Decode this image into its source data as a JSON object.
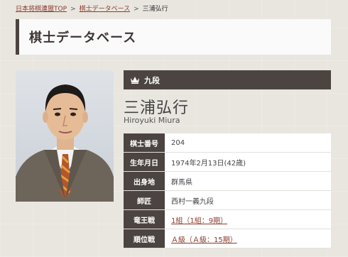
{
  "breadcrumb": {
    "home": "日本将棋連盟TOP",
    "section": "棋士データベース",
    "current": "三浦弘行",
    "separator": ">"
  },
  "page_title": "棋士データベース",
  "rank": "九段",
  "name_jp": "三浦弘行",
  "name_en": "Hiroyuki Miura",
  "profile": [
    {
      "label": "棋士番号",
      "value": "204",
      "link": false
    },
    {
      "label": "生年月日",
      "value": "1974年2月13日(42歳)",
      "link": false
    },
    {
      "label": "出身地",
      "value": "群馬県",
      "link": false
    },
    {
      "label": "師匠",
      "value": "西村一義九段",
      "link": false
    },
    {
      "label": "竜王戦",
      "value": "1組（1組：9期）",
      "link": true
    },
    {
      "label": "順位戦",
      "value": "Ａ級（Ａ級：15期）",
      "link": true
    }
  ],
  "icons": {
    "crown": "crown-icon"
  },
  "colors": {
    "header_dark": "#4b4441",
    "link": "#8b3a2a",
    "background": "#e9e6e0"
  }
}
